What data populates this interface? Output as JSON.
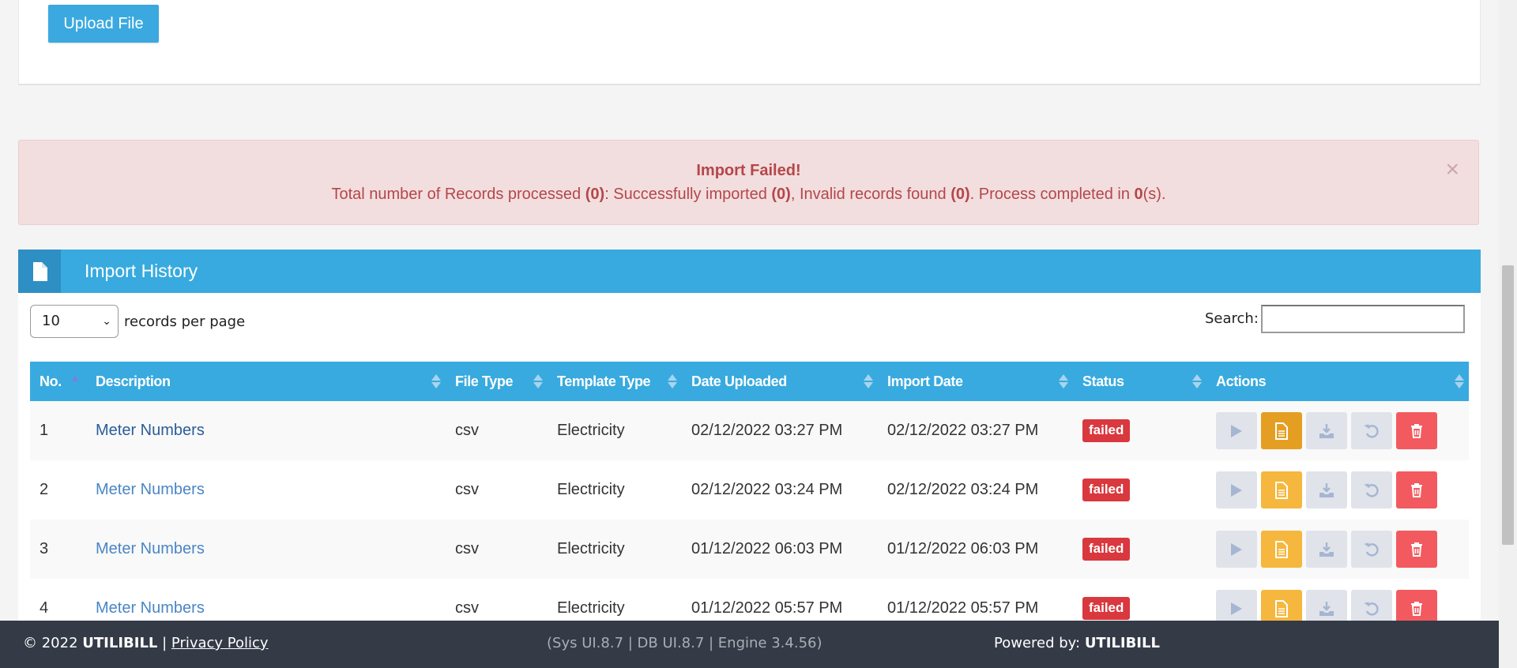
{
  "upload": {
    "button_label": "Upload File"
  },
  "alert": {
    "title": "Import Failed!",
    "msg_part1": "Total number of Records processed ",
    "total_records": "(0)",
    "msg_part2": ": Successfully imported ",
    "imported": "(0)",
    "msg_part3": ", Invalid records found ",
    "invalid": "(0)",
    "msg_part4": ". Process completed in ",
    "seconds": "0",
    "msg_part5": "(s).",
    "close_symbol": "×"
  },
  "panel": {
    "title": "Import History",
    "page_length": "10",
    "page_length_label": "records per page",
    "search_label": "Search:",
    "search_value": ""
  },
  "table": {
    "headers": [
      "No.",
      "Description",
      "File Type",
      "Template Type",
      "Date Uploaded",
      "Import Date",
      "Status",
      "Actions"
    ],
    "rows": [
      {
        "no": "1",
        "description": "Meter Numbers",
        "file_type": "csv",
        "template_type": "Electricity",
        "date_uploaded": "02/12/2022 03:27 PM",
        "import_date": "02/12/2022 03:27 PM",
        "status": "failed"
      },
      {
        "no": "2",
        "description": "Meter Numbers",
        "file_type": "csv",
        "template_type": "Electricity",
        "date_uploaded": "02/12/2022 03:24 PM",
        "import_date": "02/12/2022 03:24 PM",
        "status": "failed"
      },
      {
        "no": "3",
        "description": "Meter Numbers",
        "file_type": "csv",
        "template_type": "Electricity",
        "date_uploaded": "01/12/2022 06:03 PM",
        "import_date": "01/12/2022 06:03 PM",
        "status": "failed"
      },
      {
        "no": "4",
        "description": "Meter Numbers",
        "file_type": "csv",
        "template_type": "Electricity",
        "date_uploaded": "01/12/2022 05:57 PM",
        "import_date": "01/12/2022 05:57 PM",
        "status": "failed"
      }
    ],
    "action_icons": [
      "play-icon",
      "document-icon",
      "download-icon",
      "undo-icon",
      "trash-icon"
    ]
  },
  "footer": {
    "copyright": "© 2022 ",
    "brand": "UTILIBILL",
    "separator": " | ",
    "privacy_link": "Privacy Policy",
    "version": "(Sys UI.8.7 | DB UI.8.7 | Engine 3.4.56)",
    "powered_label": "Powered by: ",
    "powered_brand": "UTILIBILL"
  },
  "colors": {
    "primary": "#38aadf",
    "alert_bg": "#f2dede",
    "alert_text": "#b5464a",
    "failed_badge": "#d9383e",
    "footer_bg": "#343a46"
  }
}
